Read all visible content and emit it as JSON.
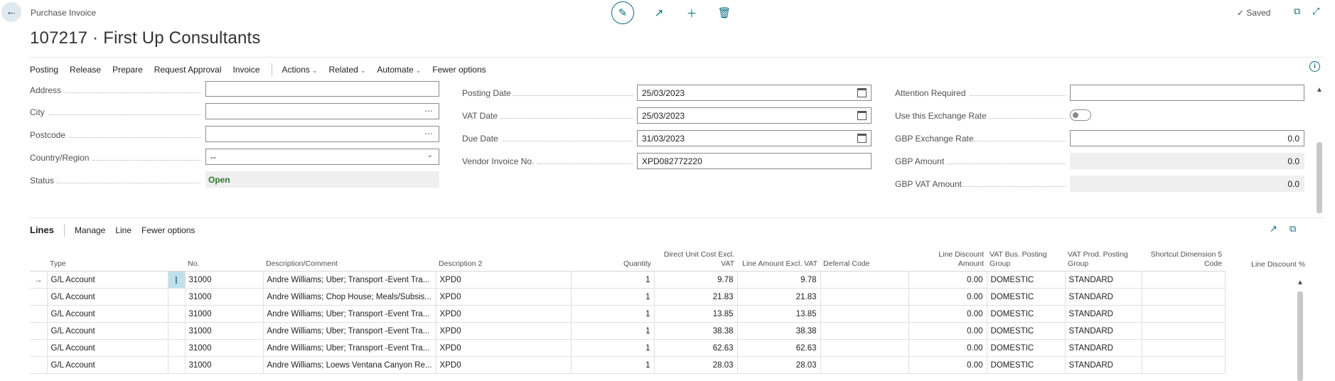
{
  "header": {
    "page_kind": "Purchase Invoice",
    "title": "107217 · First Up Consultants",
    "saved_label": "Saved"
  },
  "actions": {
    "primary": [
      "Posting",
      "Release",
      "Prepare",
      "Request Approval",
      "Invoice"
    ],
    "menus": [
      "Actions",
      "Related",
      "Automate"
    ],
    "fewer_options": "Fewer options"
  },
  "left_fields": {
    "address_label": "Address",
    "city_label": "City",
    "postcode_label": "Postcode",
    "country_label": "Country/Region",
    "country_value": "--",
    "status_label": "Status",
    "status_value": "Open"
  },
  "mid_fields": {
    "posting_date_label": "Posting Date",
    "posting_date": "25/03/2023",
    "vat_date_label": "VAT Date",
    "vat_date": "25/03/2023",
    "due_date_label": "Due Date",
    "due_date": "31/03/2023",
    "vendor_invoice_label": "Vendor Invoice No.",
    "vendor_invoice": "XPD082772220"
  },
  "right_fields": {
    "attention_label": "Attention Required",
    "attention_value": "",
    "exchange_toggle_label": "Use this Exchange Rate",
    "rate_label": "GBP Exchange Rate",
    "rate_value": "0.0",
    "amount_label": "GBP Amount",
    "amount_value": "0.0",
    "vat_amount_label": "GBP VAT Amount",
    "vat_amount_value": "0.0"
  },
  "lines": {
    "title": "Lines",
    "manage": "Manage",
    "line": "Line",
    "fewer_options": "Fewer options",
    "columns": {
      "type": "Type",
      "no": "No.",
      "desc": "Description/Comment",
      "desc2": "Description 2",
      "qty": "Quantity",
      "unit_cost": "Direct Unit Cost Excl. VAT",
      "line_amount": "Line Amount Excl. VAT",
      "deferral": "Deferral Code",
      "discount_amount": "Line Discount Amount",
      "vat_bus": "VAT Bus. Posting Group",
      "vat_prod": "VAT Prod. Posting Group",
      "shortcut": "Shortcut Dimension 5 Code",
      "discount_pct": "Line Discount %"
    },
    "rows": [
      {
        "type": "G/L Account",
        "no": "31000",
        "desc": "Andre Williams; Uber; Transport -Event Tra...",
        "desc2": "XPD0",
        "qty": "1",
        "unit": "9.78",
        "amount": "9.78",
        "deferral": "",
        "disc_amt": "0.00",
        "vat_bus": "DOMESTIC",
        "vat_prod": "STANDARD"
      },
      {
        "type": "G/L Account",
        "no": "31000",
        "desc": "Andre Williams; Chop House; Meals/Subsis...",
        "desc2": "XPD0",
        "qty": "1",
        "unit": "21.83",
        "amount": "21.83",
        "deferral": "",
        "disc_amt": "0.00",
        "vat_bus": "DOMESTIC",
        "vat_prod": "STANDARD"
      },
      {
        "type": "G/L Account",
        "no": "31000",
        "desc": "Andre Williams; Uber; Transport -Event Tra...",
        "desc2": "XPD0",
        "qty": "1",
        "unit": "13.85",
        "amount": "13.85",
        "deferral": "",
        "disc_amt": "0.00",
        "vat_bus": "DOMESTIC",
        "vat_prod": "STANDARD"
      },
      {
        "type": "G/L Account",
        "no": "31000",
        "desc": "Andre Williams; Uber; Transport -Event Tra...",
        "desc2": "XPD0",
        "qty": "1",
        "unit": "38.38",
        "amount": "38.38",
        "deferral": "",
        "disc_amt": "0.00",
        "vat_bus": "DOMESTIC",
        "vat_prod": "STANDARD"
      },
      {
        "type": "G/L Account",
        "no": "31000",
        "desc": "Andre Williams; Uber; Transport -Event Tra...",
        "desc2": "XPD0",
        "qty": "1",
        "unit": "62.63",
        "amount": "62.63",
        "deferral": "",
        "disc_amt": "0.00",
        "vat_bus": "DOMESTIC",
        "vat_prod": "STANDARD"
      },
      {
        "type": "G/L Account",
        "no": "31000",
        "desc": "Andre Williams; Loews Ventana Canyon Re...",
        "desc2": "XPD0",
        "qty": "1",
        "unit": "28.03",
        "amount": "28.03",
        "deferral": "",
        "disc_amt": "0.00",
        "vat_bus": "DOMESTIC",
        "vat_prod": "STANDARD"
      }
    ]
  }
}
